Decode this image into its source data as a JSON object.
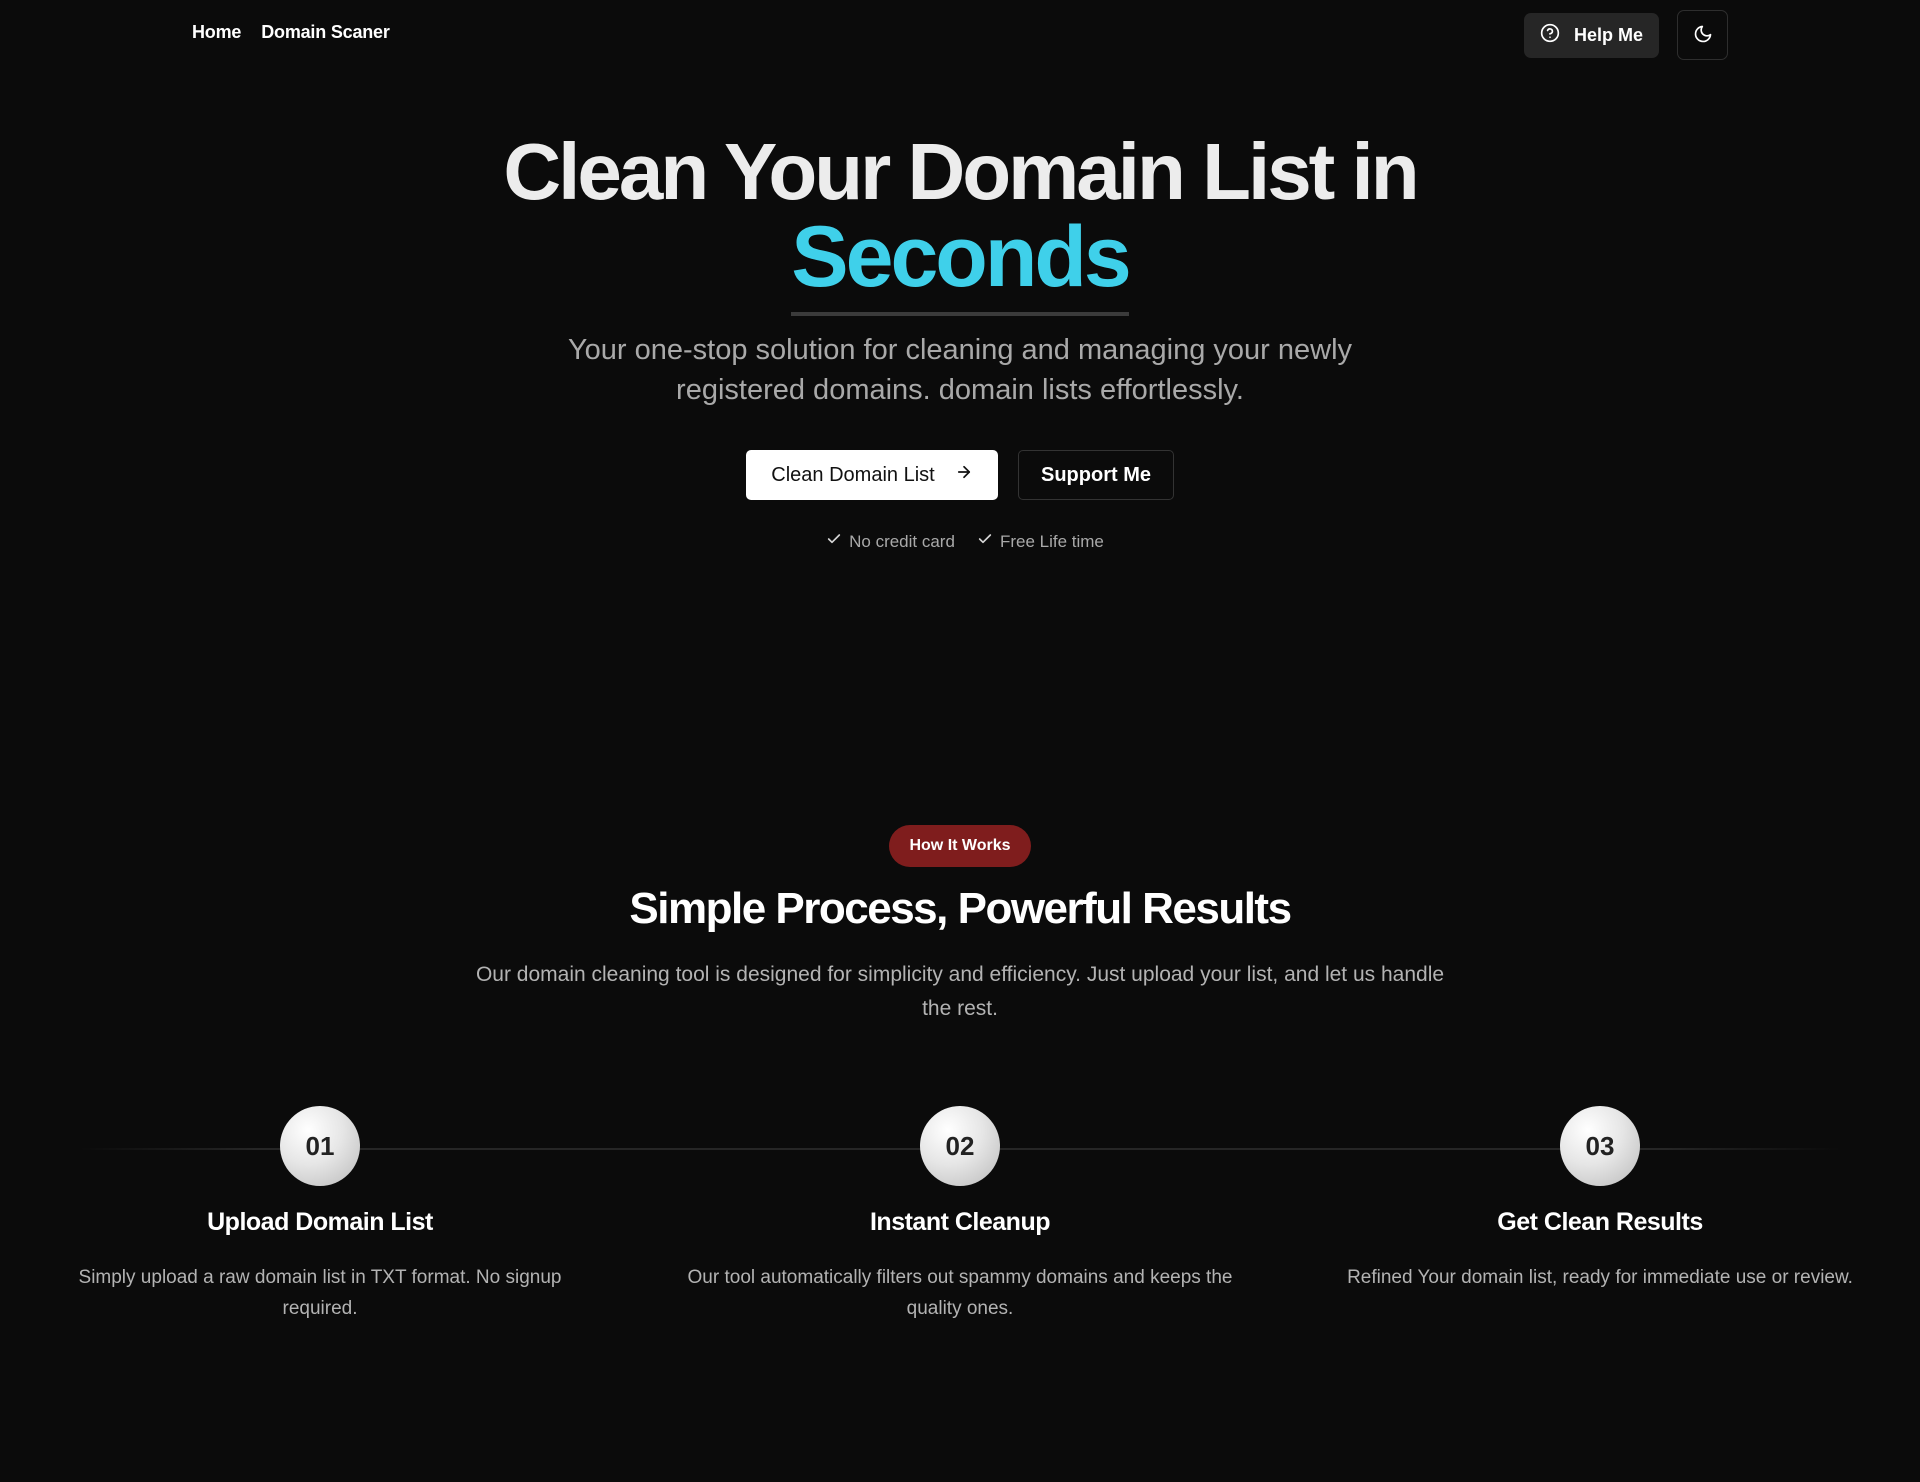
{
  "nav": {
    "links": [
      "Home",
      "Domain Scaner"
    ],
    "help_label": "Help Me",
    "help_icon": "help-circle-icon",
    "theme_icon": "moon-icon"
  },
  "hero": {
    "title_line1": "Clean Your Domain List in",
    "title_accent": "Seconds",
    "subtitle": "Your one-stop solution for cleaning and managing your newly registered domains. domain lists effortlessly.",
    "primary_cta": "Clean Domain List",
    "primary_cta_icon": "arrow-right-icon",
    "secondary_cta": "Support Me",
    "checks": [
      "No credit card",
      "Free Life time"
    ]
  },
  "how": {
    "badge": "How It Works",
    "title": "Simple Process, Powerful Results",
    "subtitle": "Our domain cleaning tool is designed for simplicity and efficiency. Just upload your list, and let us handle the rest.",
    "steps": [
      {
        "num": "01",
        "title": "Upload Domain List",
        "desc": "Simply upload a raw domain list in TXT format. No signup required."
      },
      {
        "num": "02",
        "title": "Instant Cleanup",
        "desc": "Our tool automatically filters out spammy domains and keeps the quality ones."
      },
      {
        "num": "03",
        "title": "Get Clean Results",
        "desc": "Refined Your domain list, ready for immediate use or review."
      }
    ]
  },
  "colors": {
    "background": "#0b0b0b",
    "accent": "#3fd0ea",
    "badge": "#7f1d1d"
  }
}
